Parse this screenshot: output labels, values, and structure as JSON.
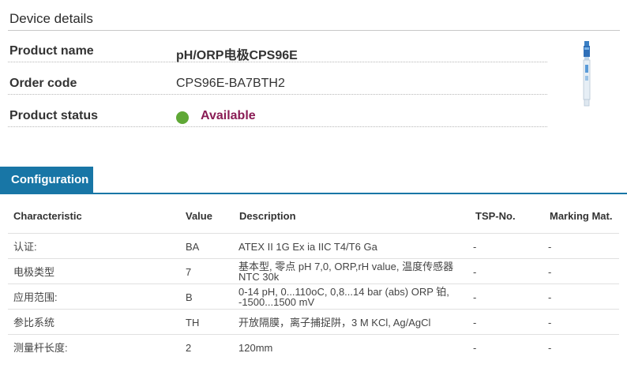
{
  "device_details": {
    "title": "Device details",
    "product_name_label": "Product name",
    "product_name_value": "pH/ORP电极CPS96E",
    "order_code_label": "Order code",
    "order_code_value": "CPS96E-BA7BTH2",
    "product_status_label": "Product status",
    "product_status_value": "Available",
    "status_color": "#5fa836",
    "status_text_color": "#8a1c55",
    "product_image_icon": "ph-electrode-icon"
  },
  "configuration": {
    "tab_label": "Configuration",
    "accent_color": "#1876a6",
    "headers": {
      "characteristic": "Characteristic",
      "value": "Value",
      "description": "Description",
      "tsp": "TSP-No.",
      "marking": "Marking Mat."
    },
    "rows": [
      {
        "characteristic": "认证:",
        "value": "BA",
        "description_1": "ATEX II 1G Ex ia IIC T4/T6 Ga",
        "description_2": "",
        "tsp": "-",
        "marking": "-"
      },
      {
        "characteristic": "电极类型",
        "value": "7",
        "description_1": "基本型, 零点 pH 7,0, ORP,rH value, 温度传感器",
        "description_2": "NTC 30k",
        "tsp": "-",
        "marking": "-"
      },
      {
        "characteristic": "应用范围:",
        "value": "B",
        "description_1": "0-14 pH, 0...110oC, 0,8...14 bar (abs) ORP 铂,",
        "description_2": "-1500...1500 mV",
        "tsp": "-",
        "marking": "-"
      },
      {
        "characteristic": "参比系统",
        "value": "TH",
        "description_1": "开放隔膜，离子捕捉阱，3 M KCl, Ag/AgCl",
        "description_2": "",
        "tsp": "-",
        "marking": "-"
      },
      {
        "characteristic": "测量杆长度:",
        "value": "2",
        "description_1": "120mm",
        "description_2": "",
        "tsp": "-",
        "marking": "-"
      }
    ]
  }
}
